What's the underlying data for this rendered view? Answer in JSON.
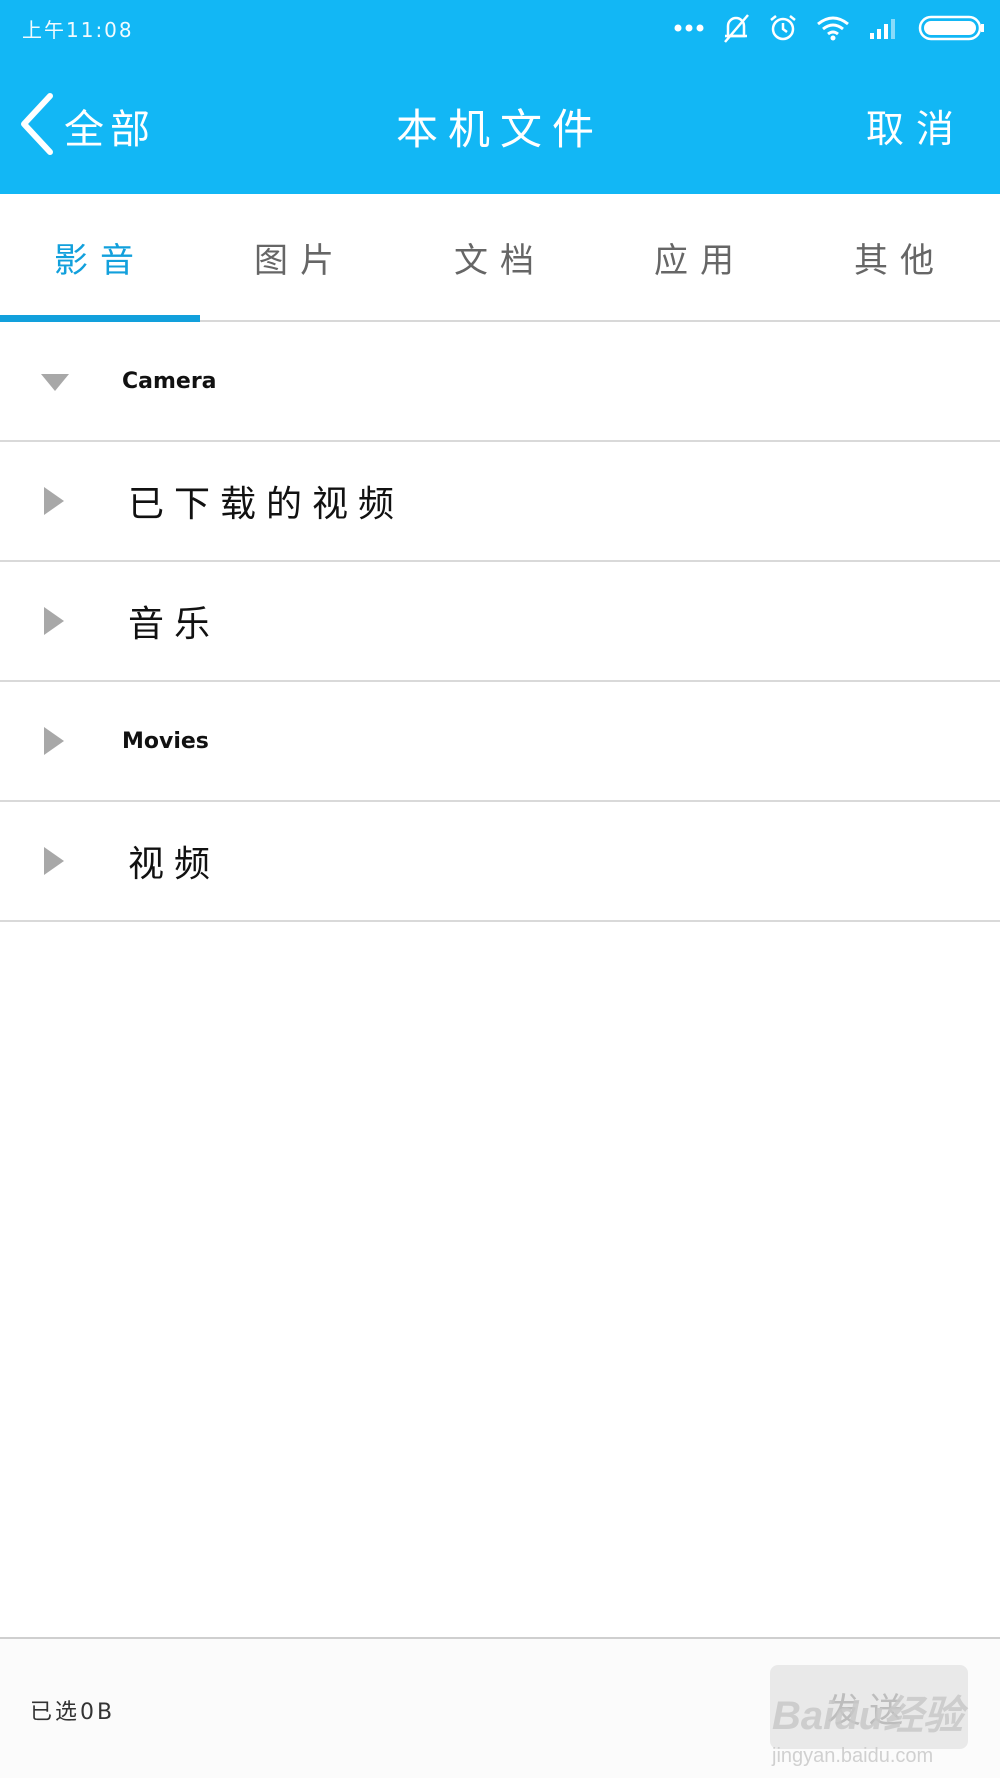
{
  "status_bar": {
    "time": "上午11:08",
    "icons": [
      "more-dots-icon",
      "mute-bell-icon",
      "alarm-icon",
      "wifi-icon",
      "signal-icon",
      "battery-icon"
    ]
  },
  "header": {
    "back_label": "全部",
    "title": "本机文件",
    "cancel_label": "取消",
    "background_color": "#12b7f5"
  },
  "tabs": [
    {
      "label": "影音",
      "active": true
    },
    {
      "label": "图片",
      "active": false
    },
    {
      "label": "文档",
      "active": false
    },
    {
      "label": "应用",
      "active": false
    },
    {
      "label": "其他",
      "active": false
    }
  ],
  "accent_color": "#12a0dc",
  "folders": [
    {
      "name": "Camera",
      "expanded": true
    },
    {
      "name": "已下载的视频",
      "expanded": false
    },
    {
      "name": "音乐",
      "expanded": false
    },
    {
      "name": "Movies",
      "expanded": false
    },
    {
      "name": "视频",
      "expanded": false
    }
  ],
  "bottom_bar": {
    "selected_text": "已选0B",
    "send_label": "发送"
  },
  "watermark": {
    "logo": "Baidu经验",
    "url": "jingyan.baidu.com"
  }
}
